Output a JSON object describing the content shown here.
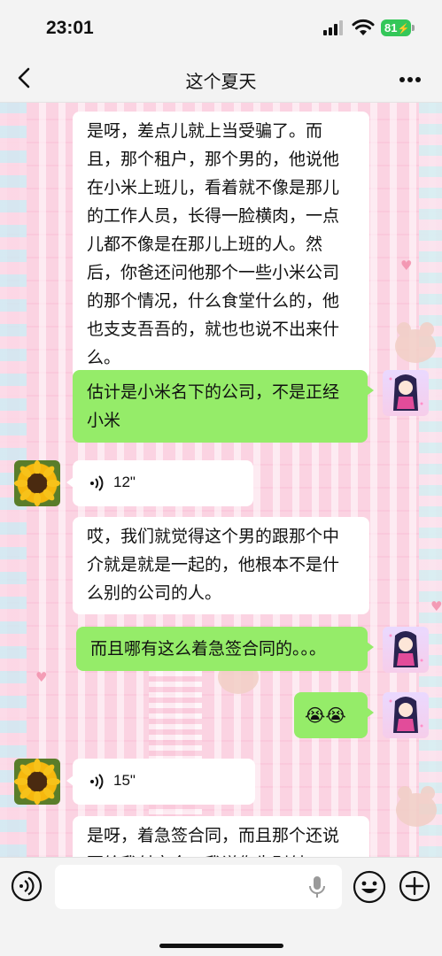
{
  "status_bar": {
    "time": "23:01",
    "battery": "81"
  },
  "nav": {
    "title": "这个夏天"
  },
  "messages": [
    {
      "side": "in",
      "type": "text",
      "text": "是呀，差点儿就上当受骗了。而且，那个租户，那个男的，他说他在小米上班儿，看着就不像是那儿的工作人员，长得一脸横肉，一点儿都不像是在那儿上班的人。然后，你爸还问他那个一些小米公司的那个情况，什么食堂什么的，他也支支吾吾的，就也也说不出来什么。"
    },
    {
      "side": "out",
      "type": "text",
      "text": "估计是小米名下的公司，不是正经小米"
    },
    {
      "side": "in",
      "type": "voice",
      "duration": "12\""
    },
    {
      "side": "in",
      "type": "text",
      "text": "哎，我们就觉得这个男的跟那个中介就是就是一起的，他根本不是什么别的公司的人。"
    },
    {
      "side": "out",
      "type": "text",
      "text": "而且哪有这么着急签合同的。。。"
    },
    {
      "side": "out",
      "type": "emoji",
      "text": "😭😭"
    },
    {
      "side": "in",
      "type": "voice",
      "duration": "15\""
    },
    {
      "side": "in",
      "type": "text",
      "text": "是呀，着急签合同，而且那个还说要给我付定金，我说你先别付"
    }
  ],
  "icons": {
    "back": "chevron-left-icon",
    "more": "more-dots-icon",
    "voice_toggle": "voice-mode-icon",
    "mic": "microphone-icon",
    "emoji": "emoji-icon",
    "plus": "plus-icon"
  },
  "colors": {
    "outgoing_bubble": "#95ec69",
    "incoming_bubble": "#ffffff",
    "wallpaper": "#fbd3e2",
    "battery": "#34c759"
  }
}
